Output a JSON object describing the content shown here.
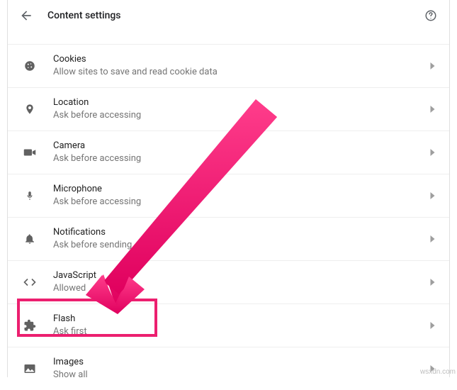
{
  "header": {
    "title": "Content settings"
  },
  "rows": [
    {
      "icon": "cookie-icon",
      "title": "Cookies",
      "sub": "Allow sites to save and read cookie data"
    },
    {
      "icon": "location-icon",
      "title": "Location",
      "sub": "Ask before accessing"
    },
    {
      "icon": "camera-icon",
      "title": "Camera",
      "sub": "Ask before accessing"
    },
    {
      "icon": "microphone-icon",
      "title": "Microphone",
      "sub": "Ask before accessing"
    },
    {
      "icon": "notifications-icon",
      "title": "Notifications",
      "sub": "Ask before sending"
    },
    {
      "icon": "javascript-icon",
      "title": "JavaScript",
      "sub": "Allowed"
    },
    {
      "icon": "flash-icon",
      "title": "Flash",
      "sub": "Ask first"
    },
    {
      "icon": "images-icon",
      "title": "Images",
      "sub": "Show all"
    }
  ],
  "watermark": "wsxdn.com",
  "highlight": {
    "target_index": 6
  }
}
